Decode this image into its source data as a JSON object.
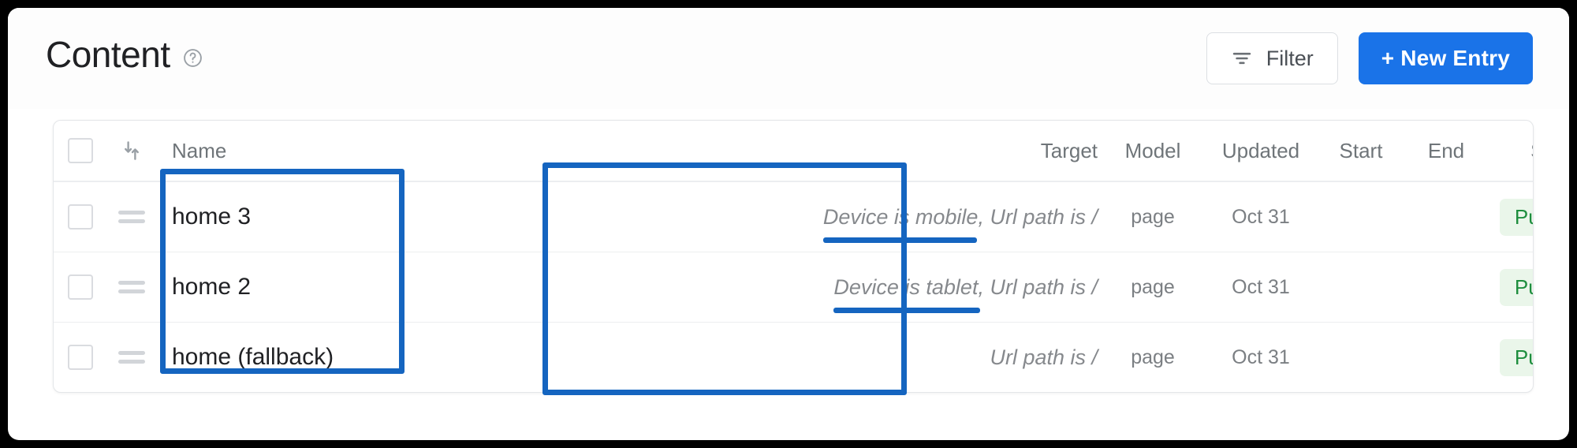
{
  "header": {
    "title": "Content",
    "help_icon": "help-circle-icon",
    "filter_label": "Filter",
    "filter_icon": "filter-icon",
    "new_entry_label": "+ New Entry",
    "accent_color": "#1A73E8"
  },
  "table": {
    "select_all_checkbox": "unchecked",
    "sort_icon": "sort-arrows-icon",
    "columns": [
      {
        "key": "name",
        "label": "Name"
      },
      {
        "key": "target",
        "label": "Target"
      },
      {
        "key": "model",
        "label": "Model"
      },
      {
        "key": "updated",
        "label": "Updated"
      },
      {
        "key": "start",
        "label": "Start"
      },
      {
        "key": "end",
        "label": "End"
      },
      {
        "key": "status",
        "label": "Status"
      }
    ],
    "rows": [
      {
        "checkbox": "unchecked",
        "handle_icon": "drag-handle-icon",
        "name": "home 3",
        "target": "Device is mobile, Url path is /",
        "target_highlight": "Device is mobile,",
        "model": "page",
        "updated": "Oct 31",
        "start": "",
        "end": "",
        "status": "Published"
      },
      {
        "checkbox": "unchecked",
        "handle_icon": "drag-handle-icon",
        "name": "home 2",
        "target": "Device is tablet, Url path is /",
        "target_highlight": "Device is tablet,",
        "model": "page",
        "updated": "Oct 31",
        "start": "",
        "end": "",
        "status": "Published"
      },
      {
        "checkbox": "unchecked",
        "handle_icon": "drag-handle-icon",
        "name": "home (fallback)",
        "target": "Url path is /",
        "target_highlight": "",
        "model": "page",
        "updated": "Oct 31",
        "start": "",
        "end": "",
        "status": "Published"
      }
    ]
  },
  "annotations": {
    "color": "#1565C0",
    "name_column_box": "highlight-box-name-column",
    "target_column_box": "highlight-box-target-column",
    "underline_rows": [
      0,
      1
    ]
  }
}
